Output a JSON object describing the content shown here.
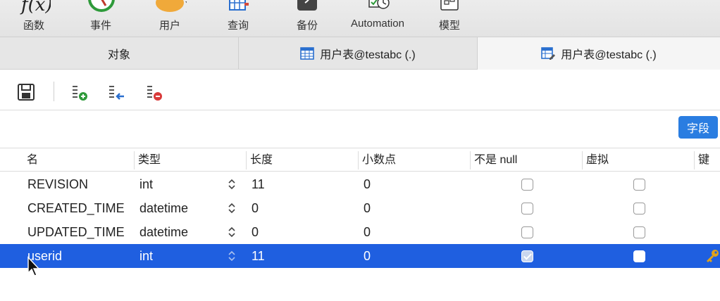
{
  "toolbar": {
    "items": [
      {
        "label": "函数",
        "icon": "function-icon"
      },
      {
        "label": "事件",
        "icon": "event-clock-icon"
      },
      {
        "label": "用户",
        "icon": "user-icon"
      },
      {
        "label": "查询",
        "icon": "query-grid-icon"
      },
      {
        "label": "备份",
        "icon": "backup-icon"
      },
      {
        "label": "Automation",
        "icon": "automation-icon"
      },
      {
        "label": "模型",
        "icon": "model-icon"
      }
    ]
  },
  "tabs": [
    {
      "label": "对象"
    },
    {
      "label": "用户表@testabc (.)",
      "icon": "table-icon"
    },
    {
      "label": "用户表@testabc (.)",
      "icon": "table-edit-icon"
    }
  ],
  "field_button": "字段",
  "columns": [
    "名",
    "类型",
    "长度",
    "小数点",
    "不是 null",
    "虚拟",
    "键"
  ],
  "rows": [
    {
      "name": "REVISION",
      "type": "int",
      "length": "11",
      "decimal": "0",
      "not_null": false,
      "virtual": false,
      "key": false
    },
    {
      "name": "CREATED_TIME",
      "type": "datetime",
      "length": "0",
      "decimal": "0",
      "not_null": false,
      "virtual": false,
      "key": false
    },
    {
      "name": "UPDATED_TIME",
      "type": "datetime",
      "length": "0",
      "decimal": "0",
      "not_null": false,
      "virtual": false,
      "key": false
    },
    {
      "name": "userid",
      "type": "int",
      "length": "11",
      "decimal": "0",
      "not_null": true,
      "virtual": false,
      "key": true
    }
  ],
  "colors": {
    "selection": "#1f5fe0",
    "accent": "#2a7de1",
    "key": "#e0a21a"
  }
}
